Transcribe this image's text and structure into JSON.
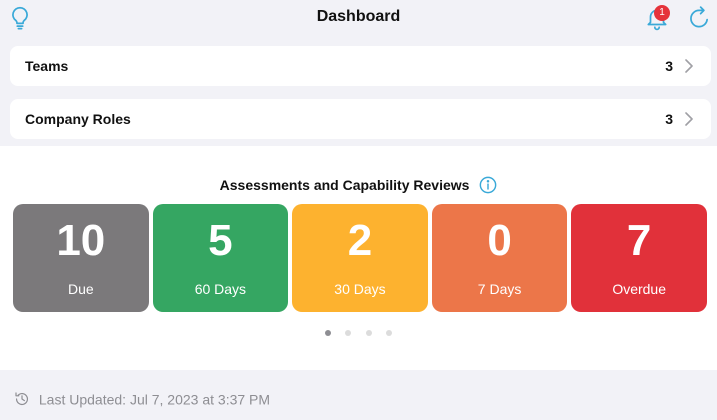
{
  "header": {
    "title": "Dashboard",
    "notification_count": "1",
    "icons": {
      "left": "lightbulb-icon",
      "bell": "bell-icon",
      "refresh": "refresh-icon"
    }
  },
  "rows": [
    {
      "label": "Teams",
      "count": "3"
    },
    {
      "label": "Company Roles",
      "count": "3"
    }
  ],
  "assessments": {
    "title": "Assessments and Capability Reviews",
    "cards": [
      {
        "value": "10",
        "label": "Due",
        "color": "#7b797b"
      },
      {
        "value": "5",
        "label": "60 Days",
        "color": "#35a662"
      },
      {
        "value": "2",
        "label": "30 Days",
        "color": "#fdb22f"
      },
      {
        "value": "0",
        "label": "7 Days",
        "color": "#ec7649"
      },
      {
        "value": "7",
        "label": "Overdue",
        "color": "#e1313a"
      }
    ],
    "page_count": 4,
    "active_page": 1
  },
  "footer": {
    "last_updated": "Last Updated: Jul 7, 2023 at 3:37 PM"
  },
  "colors": {
    "accent": "#3aa9d8",
    "badge": "#e5333b",
    "background": "#f2f2f7"
  }
}
